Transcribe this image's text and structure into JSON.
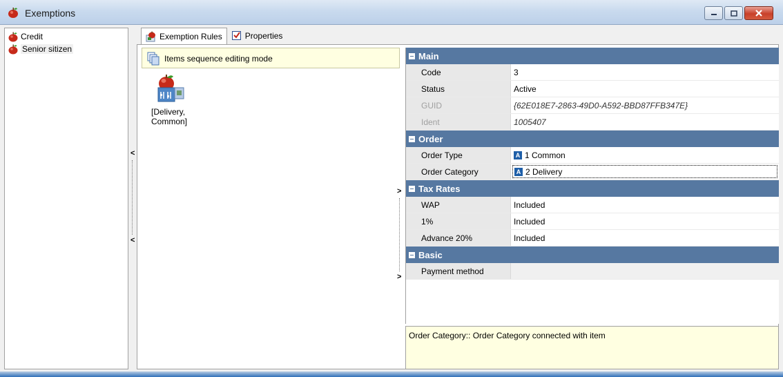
{
  "window": {
    "title": "Exemptions"
  },
  "tree": {
    "items": [
      {
        "label": "Credit"
      },
      {
        "label": "Senior sitizen"
      }
    ]
  },
  "tabs": [
    {
      "label": "Exemption Rules"
    },
    {
      "label": "Properties"
    }
  ],
  "sequence_bar": {
    "label": "Items sequence editing mode"
  },
  "item": {
    "label_line1": "[Delivery,",
    "label_line2": "Common]"
  },
  "property_grid": {
    "categories": [
      {
        "name": "Main",
        "rows": [
          {
            "name": "Code",
            "value": "3"
          },
          {
            "name": "Status",
            "value": "Active"
          },
          {
            "name": "GUID",
            "value": "{62E018E7-2863-49D0-A592-BBD87FFB347E}"
          },
          {
            "name": "Ident",
            "value": "1005407"
          }
        ]
      },
      {
        "name": "Order",
        "rows": [
          {
            "name": "Order Type",
            "value": "1 Common",
            "badge": "A"
          },
          {
            "name": "Order Category",
            "value": "2 Delivery",
            "badge": "A"
          }
        ]
      },
      {
        "name": "Tax Rates",
        "rows": [
          {
            "name": "WAP",
            "value": "Included"
          },
          {
            "name": "1%",
            "value": "Included"
          },
          {
            "name": "Advance 20%",
            "value": "Included"
          }
        ]
      },
      {
        "name": "Basic",
        "rows": [
          {
            "name": "Payment method",
            "value": ""
          }
        ]
      }
    ]
  },
  "description": {
    "text": "Order Category:: Order Category connected with item"
  },
  "colors": {
    "category_header": "#5678a1",
    "info_background": "#ffffe1",
    "badge": "#1f5fa8"
  }
}
